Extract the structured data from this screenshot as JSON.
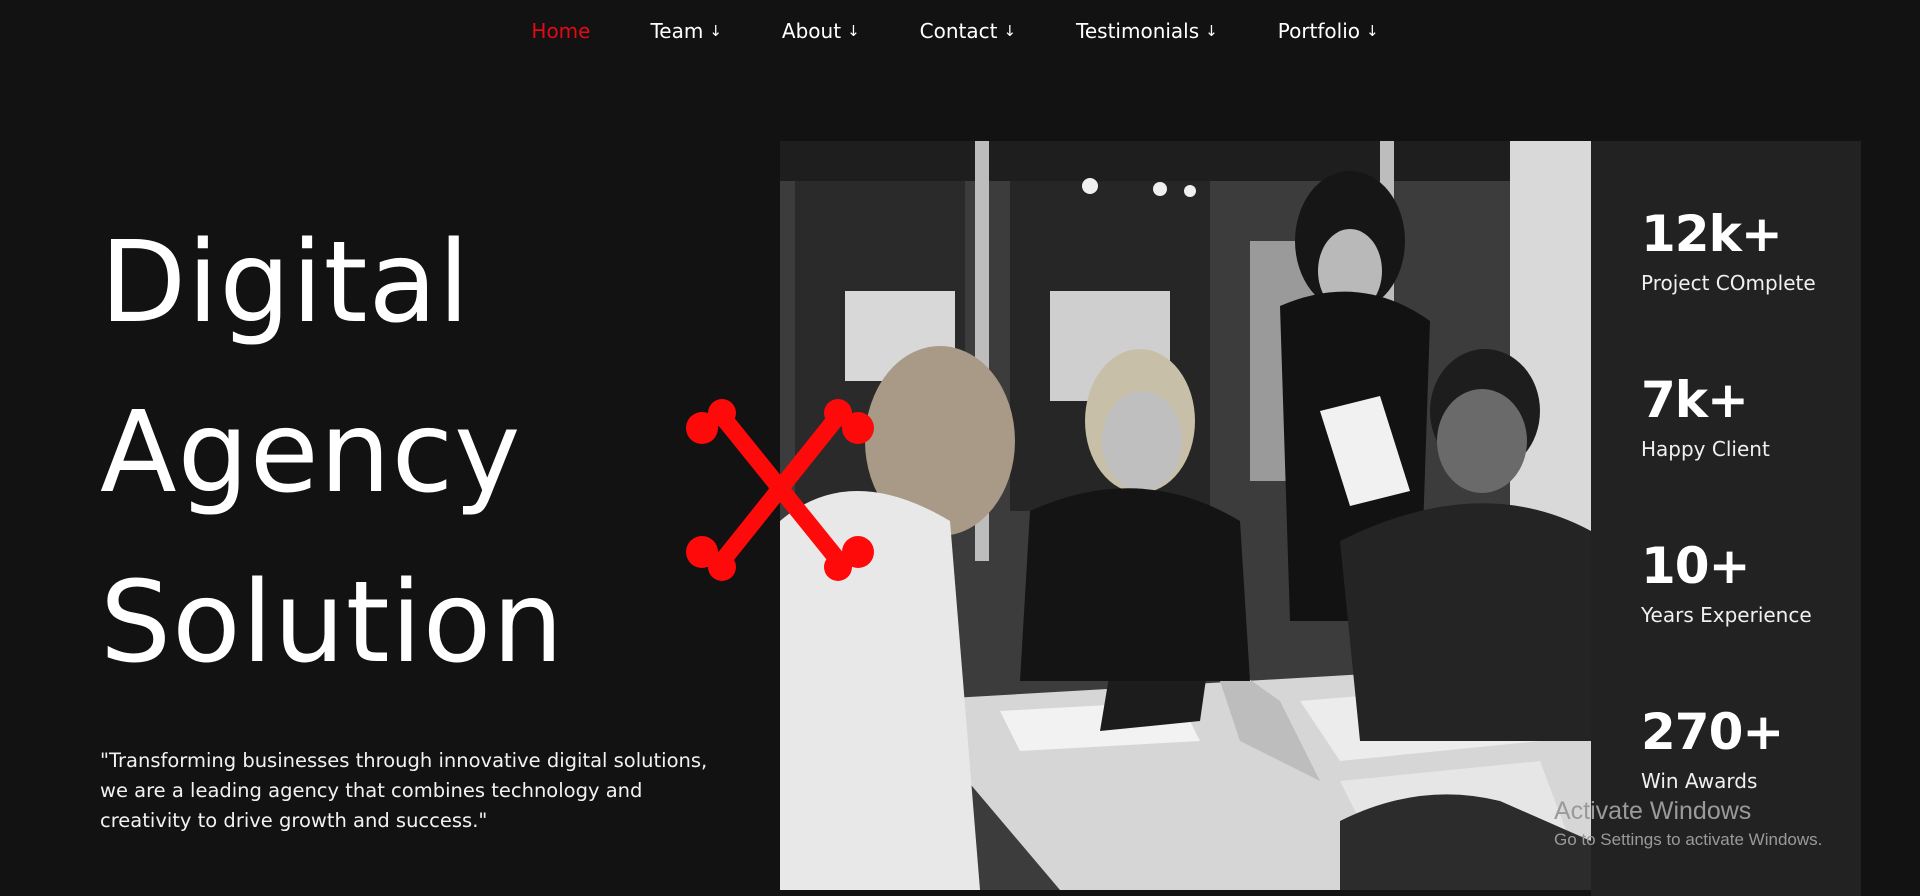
{
  "nav": {
    "items": [
      {
        "label": "Home",
        "arrow": ""
      },
      {
        "label": "Team",
        "arrow": "↓"
      },
      {
        "label": "About",
        "arrow": "↓"
      },
      {
        "label": "Contact",
        "arrow": "↓"
      },
      {
        "label": "Testimonials",
        "arrow": "↓"
      },
      {
        "label": "Portfolio",
        "arrow": "↓"
      }
    ],
    "active_color": "#e50914"
  },
  "hero": {
    "title_lines": [
      "Digital",
      "Agency",
      "Solution"
    ],
    "description": "\"Transforming businesses through innovative digital solutions, we are a leading agency that combines technology and creativity to drive growth and success.\""
  },
  "stats": [
    {
      "value": "12k+",
      "label": "Project COmplete"
    },
    {
      "value": "7k+",
      "label": "Happy Client"
    },
    {
      "value": "10+",
      "label": "Years Experience"
    },
    {
      "value": "270+",
      "label": "Win Awards"
    }
  ],
  "overlay": {
    "activate_title": "Activate Windows",
    "activate_sub": "Go to Settings to activate Windows."
  },
  "colors": {
    "background": "#121212",
    "panel": "#222222",
    "accent": "#e50914",
    "cross_mark": "#ff0a0a"
  },
  "icons": {
    "cross": "red-cross-mark-icon",
    "arrow": "arrow-down-icon"
  }
}
